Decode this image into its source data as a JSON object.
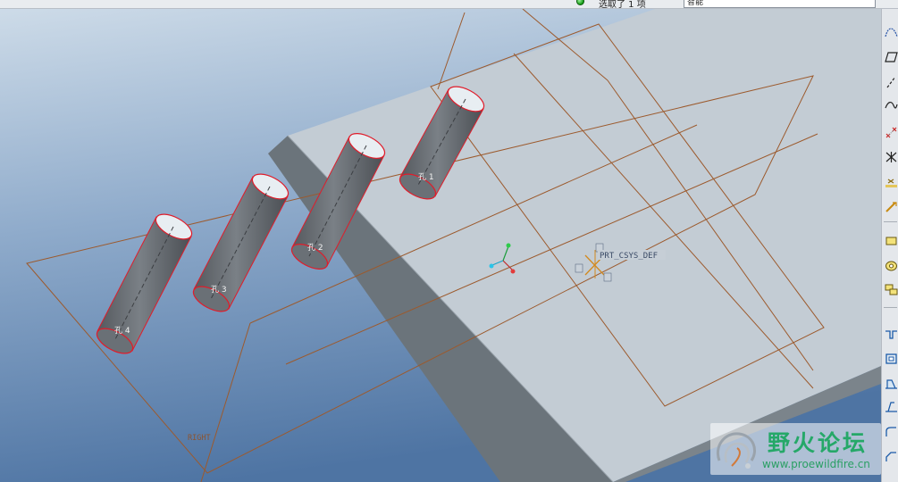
{
  "topbar": {
    "filter_label": "选取了 1 项",
    "filter_value": "智能"
  },
  "viewport": {
    "csys_label": "PRT_CSYS_DEF",
    "datum_label": "RIGHT",
    "cylinder_labels": [
      "孔 4",
      "孔 3",
      "孔 2",
      "孔 1"
    ]
  },
  "toolbar": {
    "icons": [
      "datum-curve-sketch-icon",
      "datum-plane-icon",
      "datum-axis-icon",
      "datum-curve-icon",
      "datum-point-icon",
      "datum-point-sketched-icon",
      "datum-point-offset-icon",
      "datum-csys-icon",
      "extrude-icon",
      "revolve-icon",
      "sweep-icon",
      "hole-icon",
      "shell-icon",
      "rib-icon",
      "draft-icon",
      "round-icon",
      "chamfer-icon"
    ]
  },
  "watermark": {
    "title": "野火论坛",
    "url": "www.proewildfire.cn"
  },
  "colors": {
    "background_top": "#c7d7e6",
    "background_bottom": "#557aa8",
    "plate_top": "#c4cdd5",
    "plate_side": "#6d767d",
    "cylinder": "#6f757b",
    "cylinder_edge": "#e01c2a",
    "datum_plane": "#a0522d",
    "csys": "#d38a1e"
  }
}
